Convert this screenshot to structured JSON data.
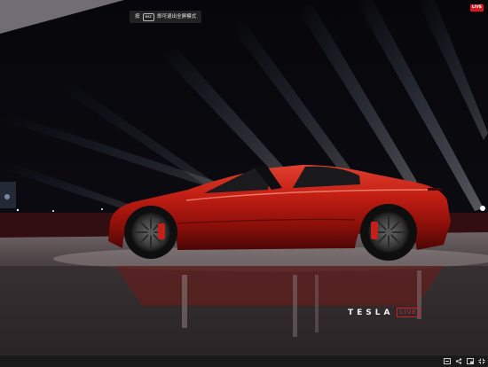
{
  "overlay": {
    "esc_prefix": "按",
    "esc_key": "esc",
    "esc_suffix": "即可退出全屏模式",
    "live_badge": "LIVE"
  },
  "watermark": {
    "brand": "TESLA",
    "live": "LIVE"
  },
  "controls": {
    "icons": [
      "caption-icon",
      "share-icon",
      "mini-player-icon",
      "exit-fullscreen-icon"
    ]
  },
  "colors": {
    "car_body": "#b0160f",
    "badge": "#e0141e",
    "background": "#000000"
  }
}
